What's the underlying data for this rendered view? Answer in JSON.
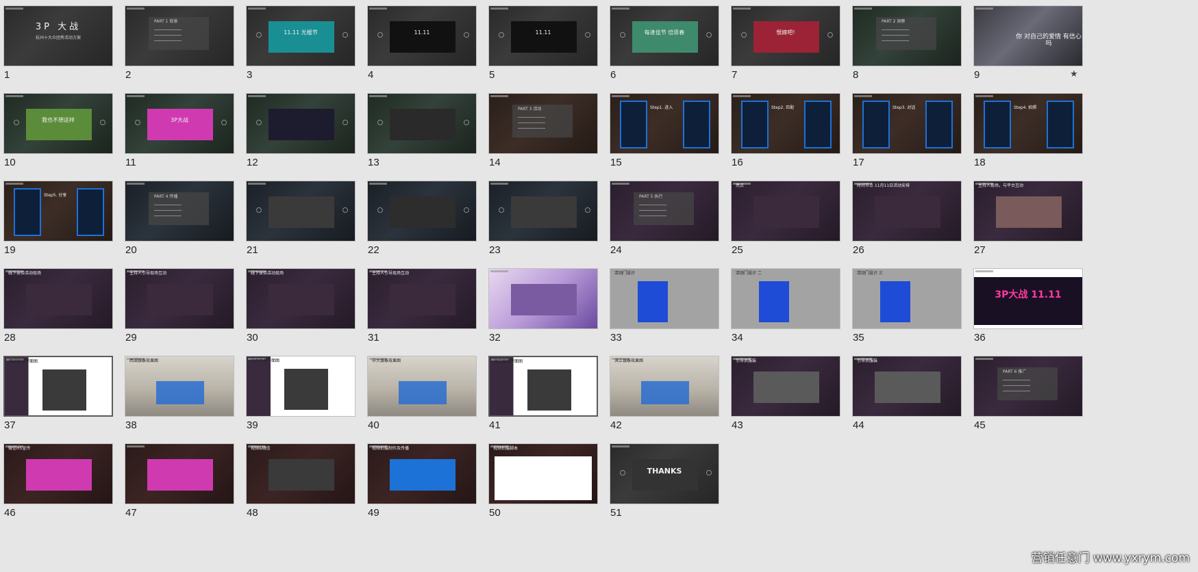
{
  "watermark": "营销任意门 www.yxrym.com",
  "slides": [
    {
      "num": "1",
      "theme": "gray",
      "title": "3P 大战",
      "sub": "杭州十大众团秀活动方案",
      "star": ""
    },
    {
      "num": "2",
      "theme": "gray",
      "title": "",
      "panel": "PART 1 背景",
      "star": ""
    },
    {
      "num": "3",
      "theme": "gray",
      "title": "11.11 光棍节",
      "accent": "#1a8f93",
      "star": ""
    },
    {
      "num": "4",
      "theme": "gray",
      "title": "11.11",
      "accent": "#111111",
      "star": ""
    },
    {
      "num": "5",
      "theme": "gray",
      "title": "11.11",
      "accent": "#111111",
      "star": ""
    },
    {
      "num": "6",
      "theme": "gray",
      "title": "每逢佳节 倍思春",
      "accent": "#3e8a6c",
      "star": ""
    },
    {
      "num": "7",
      "theme": "gray",
      "title": "恨嫁吧!",
      "accent": "#9b2335",
      "star": ""
    },
    {
      "num": "8",
      "theme": "green",
      "title": "",
      "panel": "PART 2 洞察",
      "star": ""
    },
    {
      "num": "9",
      "theme": "photo",
      "title": "你 对自己的爱情 有信心吗",
      "star": "★"
    },
    {
      "num": "10",
      "theme": "green",
      "title": "我也不想这样",
      "accent": "#5b8c3a",
      "star": ""
    },
    {
      "num": "11",
      "theme": "green",
      "title": "3P大战",
      "accent": "#d03ab0",
      "star": ""
    },
    {
      "num": "12",
      "theme": "green",
      "title": "",
      "accent": "#1c1c2e",
      "star": ""
    },
    {
      "num": "13",
      "theme": "green",
      "title": "",
      "accent": "#2a2a2a",
      "star": ""
    },
    {
      "num": "14",
      "theme": "brown",
      "title": "",
      "panel": "PART 3 活动",
      "star": ""
    },
    {
      "num": "15",
      "theme": "brown",
      "title": "Step1. 进入",
      "accent": "#1d72d8",
      "star": ""
    },
    {
      "num": "16",
      "theme": "brown",
      "title": "Step2. 匹配",
      "accent": "#1d72d8",
      "star": ""
    },
    {
      "num": "17",
      "theme": "brown",
      "title": "Step3. 对话",
      "accent": "#1d72d8",
      "star": ""
    },
    {
      "num": "18",
      "theme": "brown",
      "title": "Step4. 拍照",
      "accent": "#1d72d8",
      "star": ""
    },
    {
      "num": "19",
      "theme": "brown",
      "title": "Step5. 分享",
      "accent": "#1d72d8",
      "star": ""
    },
    {
      "num": "20",
      "theme": "navy",
      "title": "",
      "panel": "PART 4 传播",
      "star": ""
    },
    {
      "num": "21",
      "theme": "navy",
      "title": "",
      "accent": "#3a3a3a",
      "star": ""
    },
    {
      "num": "22",
      "theme": "navy",
      "title": "",
      "accent": "#2d2d2d",
      "star": ""
    },
    {
      "num": "23",
      "theme": "navy",
      "title": "",
      "accent": "#3a3a3a",
      "star": ""
    },
    {
      "num": "24",
      "theme": "purple",
      "title": "",
      "panel": "PART 5 执行",
      "star": ""
    },
    {
      "num": "25",
      "theme": "purple",
      "title": "亮点",
      "accent": "#3b2a3b",
      "star": ""
    },
    {
      "num": "26",
      "theme": "purple",
      "title": "时间节点 11月11日活动安排",
      "accent": "#3b2a3b",
      "star": ""
    },
    {
      "num": "27",
      "theme": "purple",
      "title": "主持人现场，与平台互动",
      "accent": "#7a5a5a",
      "star": ""
    },
    {
      "num": "28",
      "theme": "purple",
      "title": "线下体验活动现场",
      "accent": "#3b2a3b",
      "star": ""
    },
    {
      "num": "29",
      "theme": "purple",
      "title": "主持人引导现场互动",
      "accent": "#3b2a3b",
      "star": ""
    },
    {
      "num": "30",
      "theme": "purple",
      "title": "线下体验活动现场",
      "accent": "#3b2a3b",
      "star": ""
    },
    {
      "num": "31",
      "theme": "purple",
      "title": "主持人引导现场互动",
      "accent": "#3b2a3b",
      "star": ""
    },
    {
      "num": "32",
      "theme": "stage",
      "title": "",
      "accent": "#7a5aa0",
      "star": ""
    },
    {
      "num": "33",
      "theme": "grayplain",
      "title": "活动门设计",
      "accent": "#1e4cd6",
      "star": ""
    },
    {
      "num": "34",
      "theme": "grayplain",
      "title": "活动门设计 二",
      "accent": "#1e4cd6",
      "star": ""
    },
    {
      "num": "35",
      "theme": "grayplain",
      "title": "活动门设计 三",
      "accent": "#1e4cd6",
      "star": ""
    },
    {
      "num": "36",
      "theme": "white",
      "title": "3P大战 11.11",
      "accent": "#d02a80",
      "star": ""
    },
    {
      "num": "37",
      "theme": "purplewhite",
      "title": "西湖银泰平面图",
      "accent": "#2a6fd0",
      "star": ""
    },
    {
      "num": "38",
      "theme": "mall",
      "title": "西湖银泰效果图",
      "accent": "#2a6fd0",
      "star": ""
    },
    {
      "num": "39",
      "theme": "purplewhite",
      "title": "中大银泰平面图",
      "accent": "#2a6fd0",
      "star": ""
    },
    {
      "num": "40",
      "theme": "mall",
      "title": "中大银泰效果图",
      "accent": "#2a6fd0",
      "star": ""
    },
    {
      "num": "41",
      "theme": "purplewhite",
      "title": "滨江银泰平面图",
      "accent": "#2a6fd0",
      "star": ""
    },
    {
      "num": "42",
      "theme": "mall",
      "title": "滨江银泰效果图",
      "accent": "#2a6fd0",
      "star": ""
    },
    {
      "num": "43",
      "theme": "purple",
      "title": "引导员服装",
      "accent": "#5a5a5a",
      "star": ""
    },
    {
      "num": "44",
      "theme": "purple",
      "title": "引导员服装",
      "accent": "#5a5a5a",
      "star": ""
    },
    {
      "num": "45",
      "theme": "purple",
      "title": "",
      "panel": "PART 6 推广",
      "star": ""
    },
    {
      "num": "46",
      "theme": "darkred",
      "title": "微信H5宣传",
      "accent": "#d03ab0",
      "star": ""
    },
    {
      "num": "47",
      "theme": "darkred",
      "title": "",
      "accent": "#d03ab0",
      "star": ""
    },
    {
      "num": "48",
      "theme": "darkred",
      "title": "视频&微信",
      "accent": "#3a3a3a",
      "star": ""
    },
    {
      "num": "49",
      "theme": "darkred",
      "title": "视频拍摄制作及传播",
      "accent": "#1d72d8",
      "star": ""
    },
    {
      "num": "50",
      "theme": "darkred",
      "title": "视频拍摄脚本",
      "accent": "#ffffff",
      "star": ""
    },
    {
      "num": "51",
      "theme": "gray",
      "title": "THANKS",
      "accent": "#333333",
      "star": ""
    }
  ]
}
